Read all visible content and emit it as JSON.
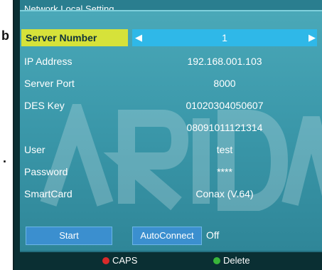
{
  "window": {
    "title": "Network Local Setting"
  },
  "edge_fragments": {
    "top": "b",
    "middle": "."
  },
  "rows": [
    {
      "label": "Server Number",
      "value": "1"
    },
    {
      "label": "IP Address",
      "value": "192.168.001.103"
    },
    {
      "label": "Server Port",
      "value": "8000"
    },
    {
      "label": "DES Key",
      "value": "01020304050607"
    },
    {
      "label": "",
      "value": "08091011121314"
    },
    {
      "label": "User",
      "value": "test"
    },
    {
      "label": "Password",
      "value": "****"
    },
    {
      "label": "SmartCard",
      "value": "Conax (V.64)"
    }
  ],
  "buttons": {
    "start": "Start",
    "autoconnect": "AutoConnect",
    "autoconnect_value": "Off"
  },
  "footer": {
    "red_hint": "CAPS",
    "green_hint": "Delete"
  },
  "icons": {
    "left": "arrow-left-icon",
    "right": "arrow-right-icon"
  },
  "colors": {
    "panel": "#3a97a9",
    "selected_label": "#d6e23a",
    "selected_value": "#2fb8e8",
    "button": "#3b8fcf",
    "red_key": "#d92a2a",
    "green_key": "#39b53a"
  }
}
